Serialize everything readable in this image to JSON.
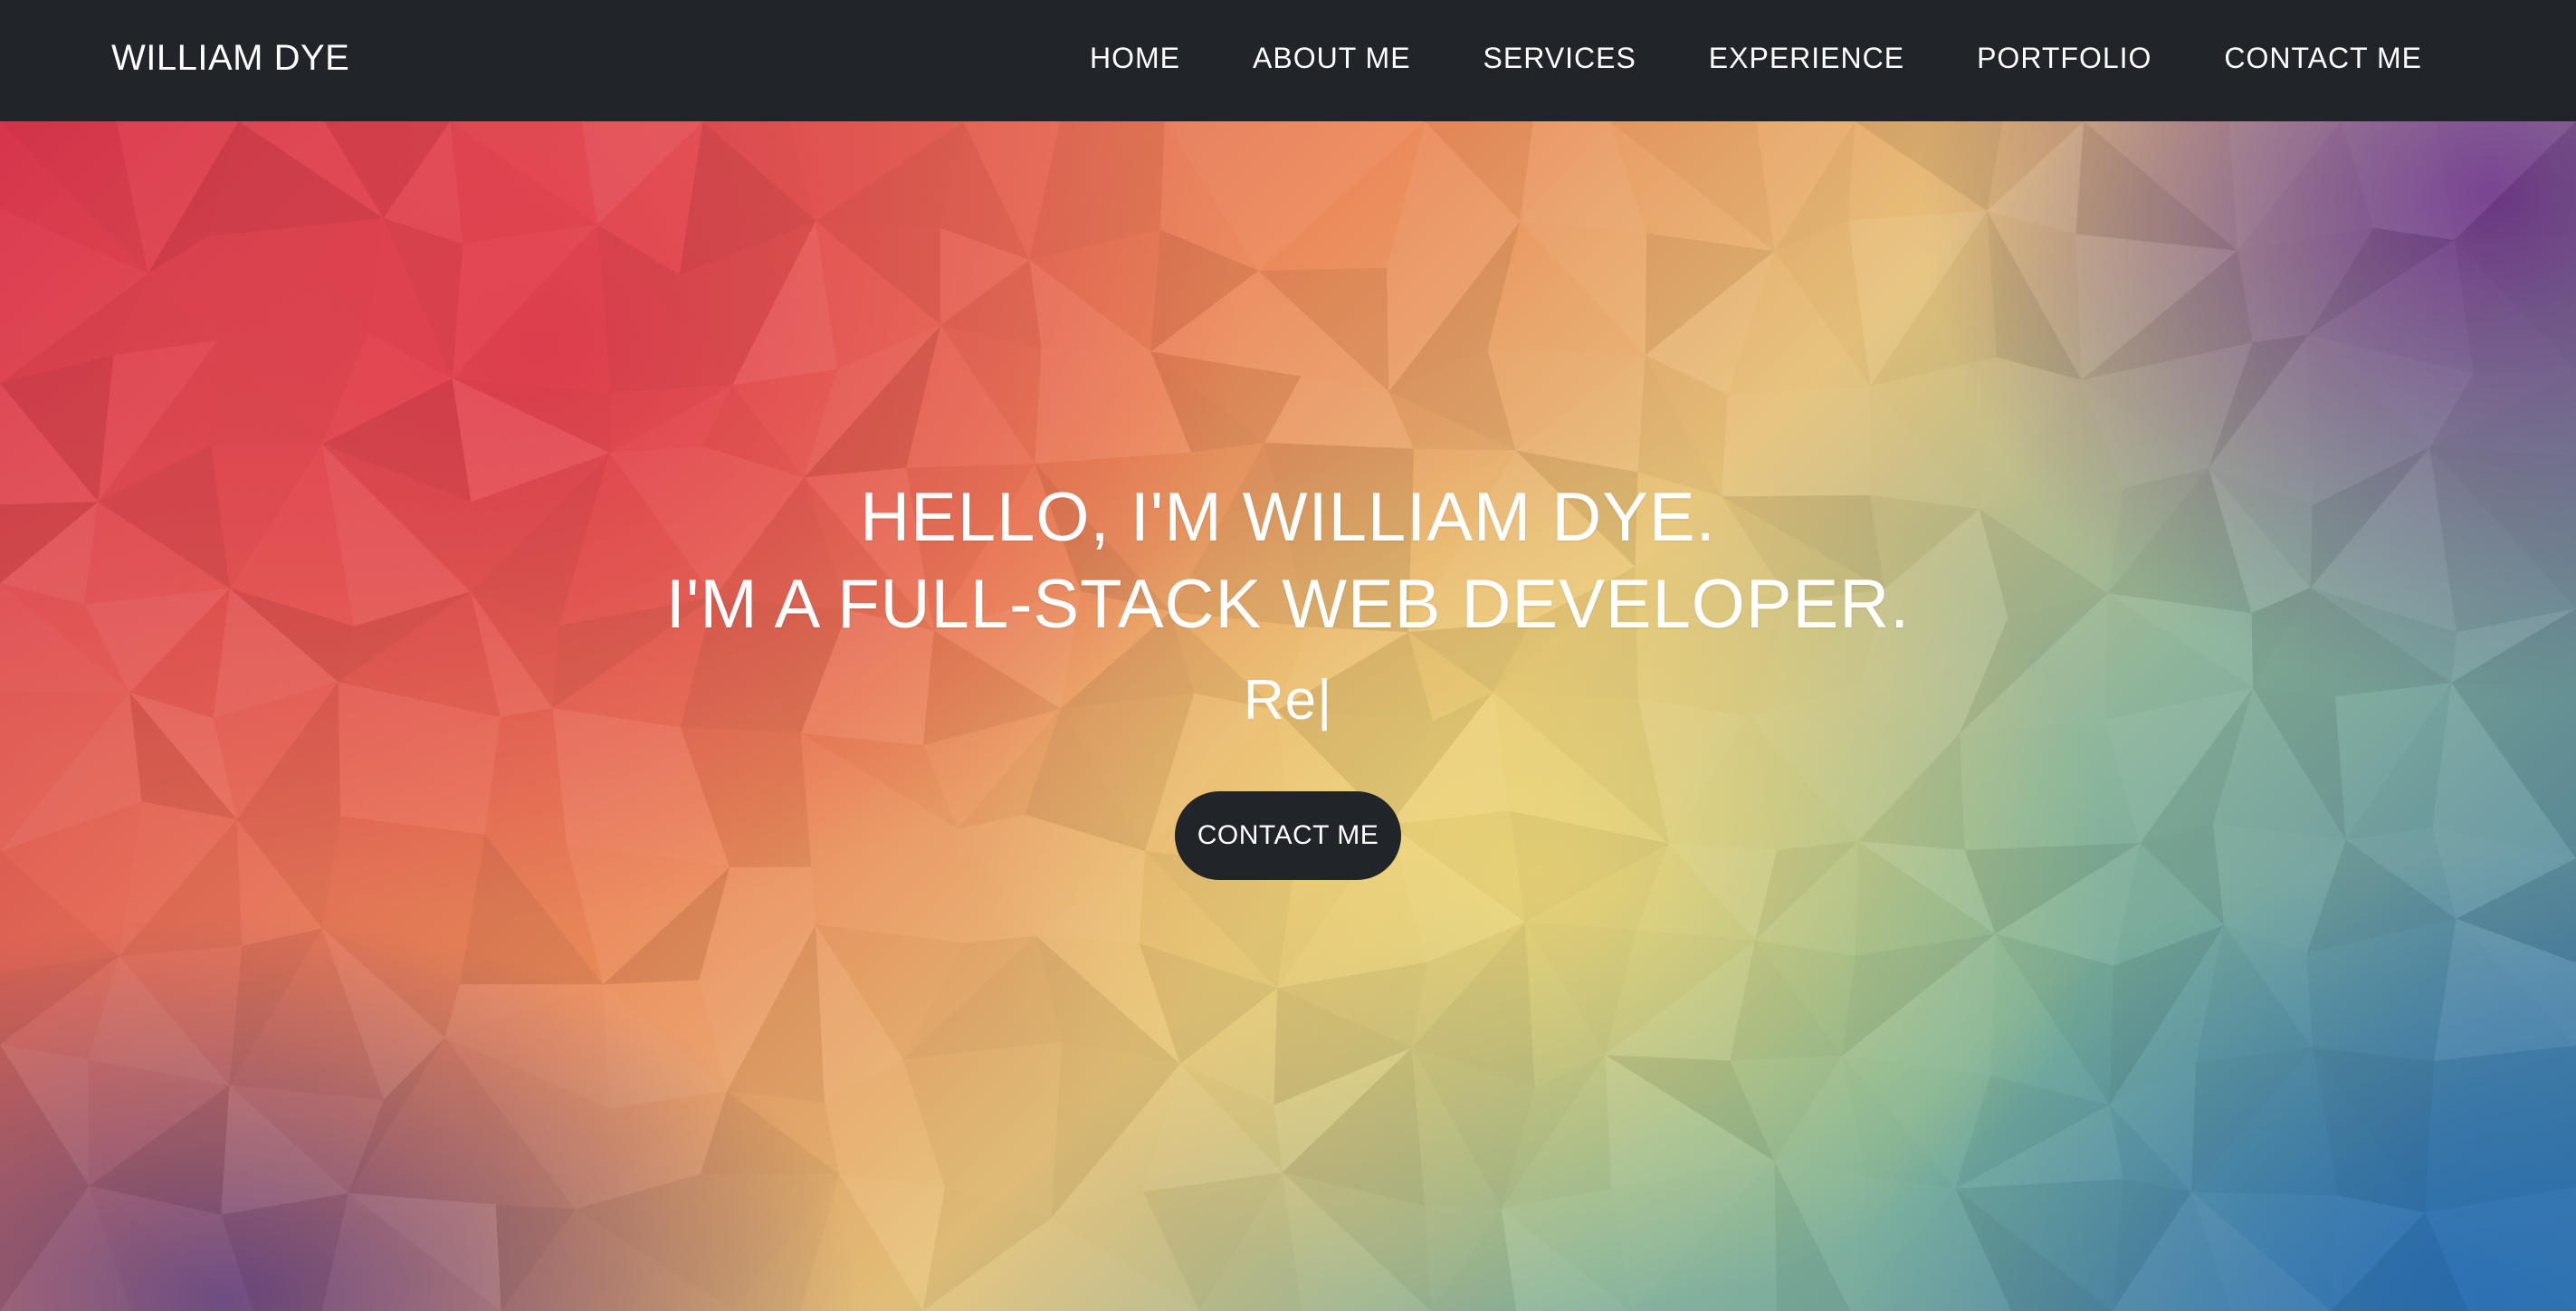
{
  "navbar": {
    "brand": "WILLIAM DYE",
    "items": [
      {
        "label": "HOME"
      },
      {
        "label": "ABOUT ME"
      },
      {
        "label": "SERVICES"
      },
      {
        "label": "EXPERIENCE"
      },
      {
        "label": "PORTFOLIO"
      },
      {
        "label": "CONTACT ME"
      }
    ],
    "background": "#212529"
  },
  "hero": {
    "headline_line1": "HELLO, I'M WILLIAM DYE.",
    "headline_line2": "I'M A FULL-STACK WEB DEVELOPER.",
    "typed_text": "Re|",
    "cta_label": "CONTACT ME",
    "cta_color": "#212529",
    "palette": [
      "#d9344e",
      "#eb8a5a",
      "#f0d878",
      "#8db59a",
      "#3f79a6",
      "#70348c"
    ]
  }
}
